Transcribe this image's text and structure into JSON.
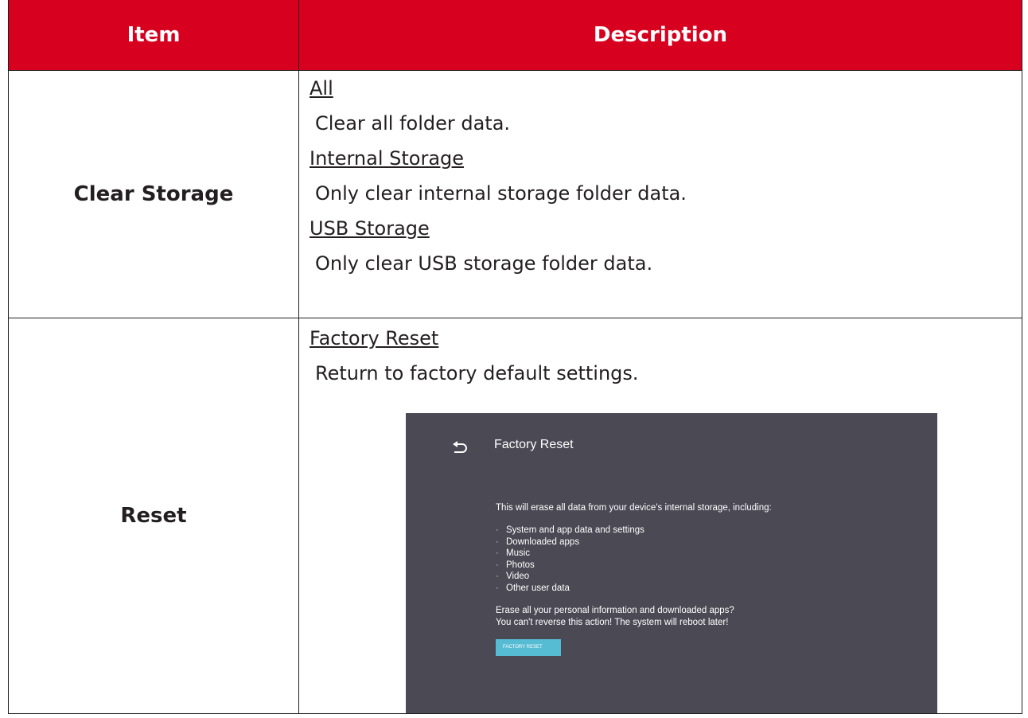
{
  "header": {
    "item": "Item",
    "description": "Description"
  },
  "rows": [
    {
      "item": "Clear Storage",
      "options": [
        {
          "title": "All",
          "text": "Clear all folder data."
        },
        {
          "title": "Internal Storage",
          "text": "Only clear internal storage folder data."
        },
        {
          "title": "USB Storage",
          "text": "Only clear USB storage folder data."
        }
      ]
    },
    {
      "item": "Reset",
      "options": [
        {
          "title": "Factory Reset",
          "text": "Return to factory default settings."
        }
      ]
    }
  ],
  "screen": {
    "title": "Factory Reset",
    "back_icon": "back-arrow-icon",
    "intro": "This will erase all data from your device's internal storage, including:",
    "bullet_char": "·",
    "bullets": [
      "System and app data and settings",
      "Downloaded apps",
      "Music",
      "Photos",
      "Video",
      "Other user data"
    ],
    "warning_line1": "Erase all your personal information and downloaded apps?",
    "warning_line2": "You can't reverse this action! The system will reboot later!",
    "button_label": "FACTORY RESET",
    "colors": {
      "background": "#4a4954",
      "button": "#56bcd4",
      "header": "#d7001f"
    }
  }
}
